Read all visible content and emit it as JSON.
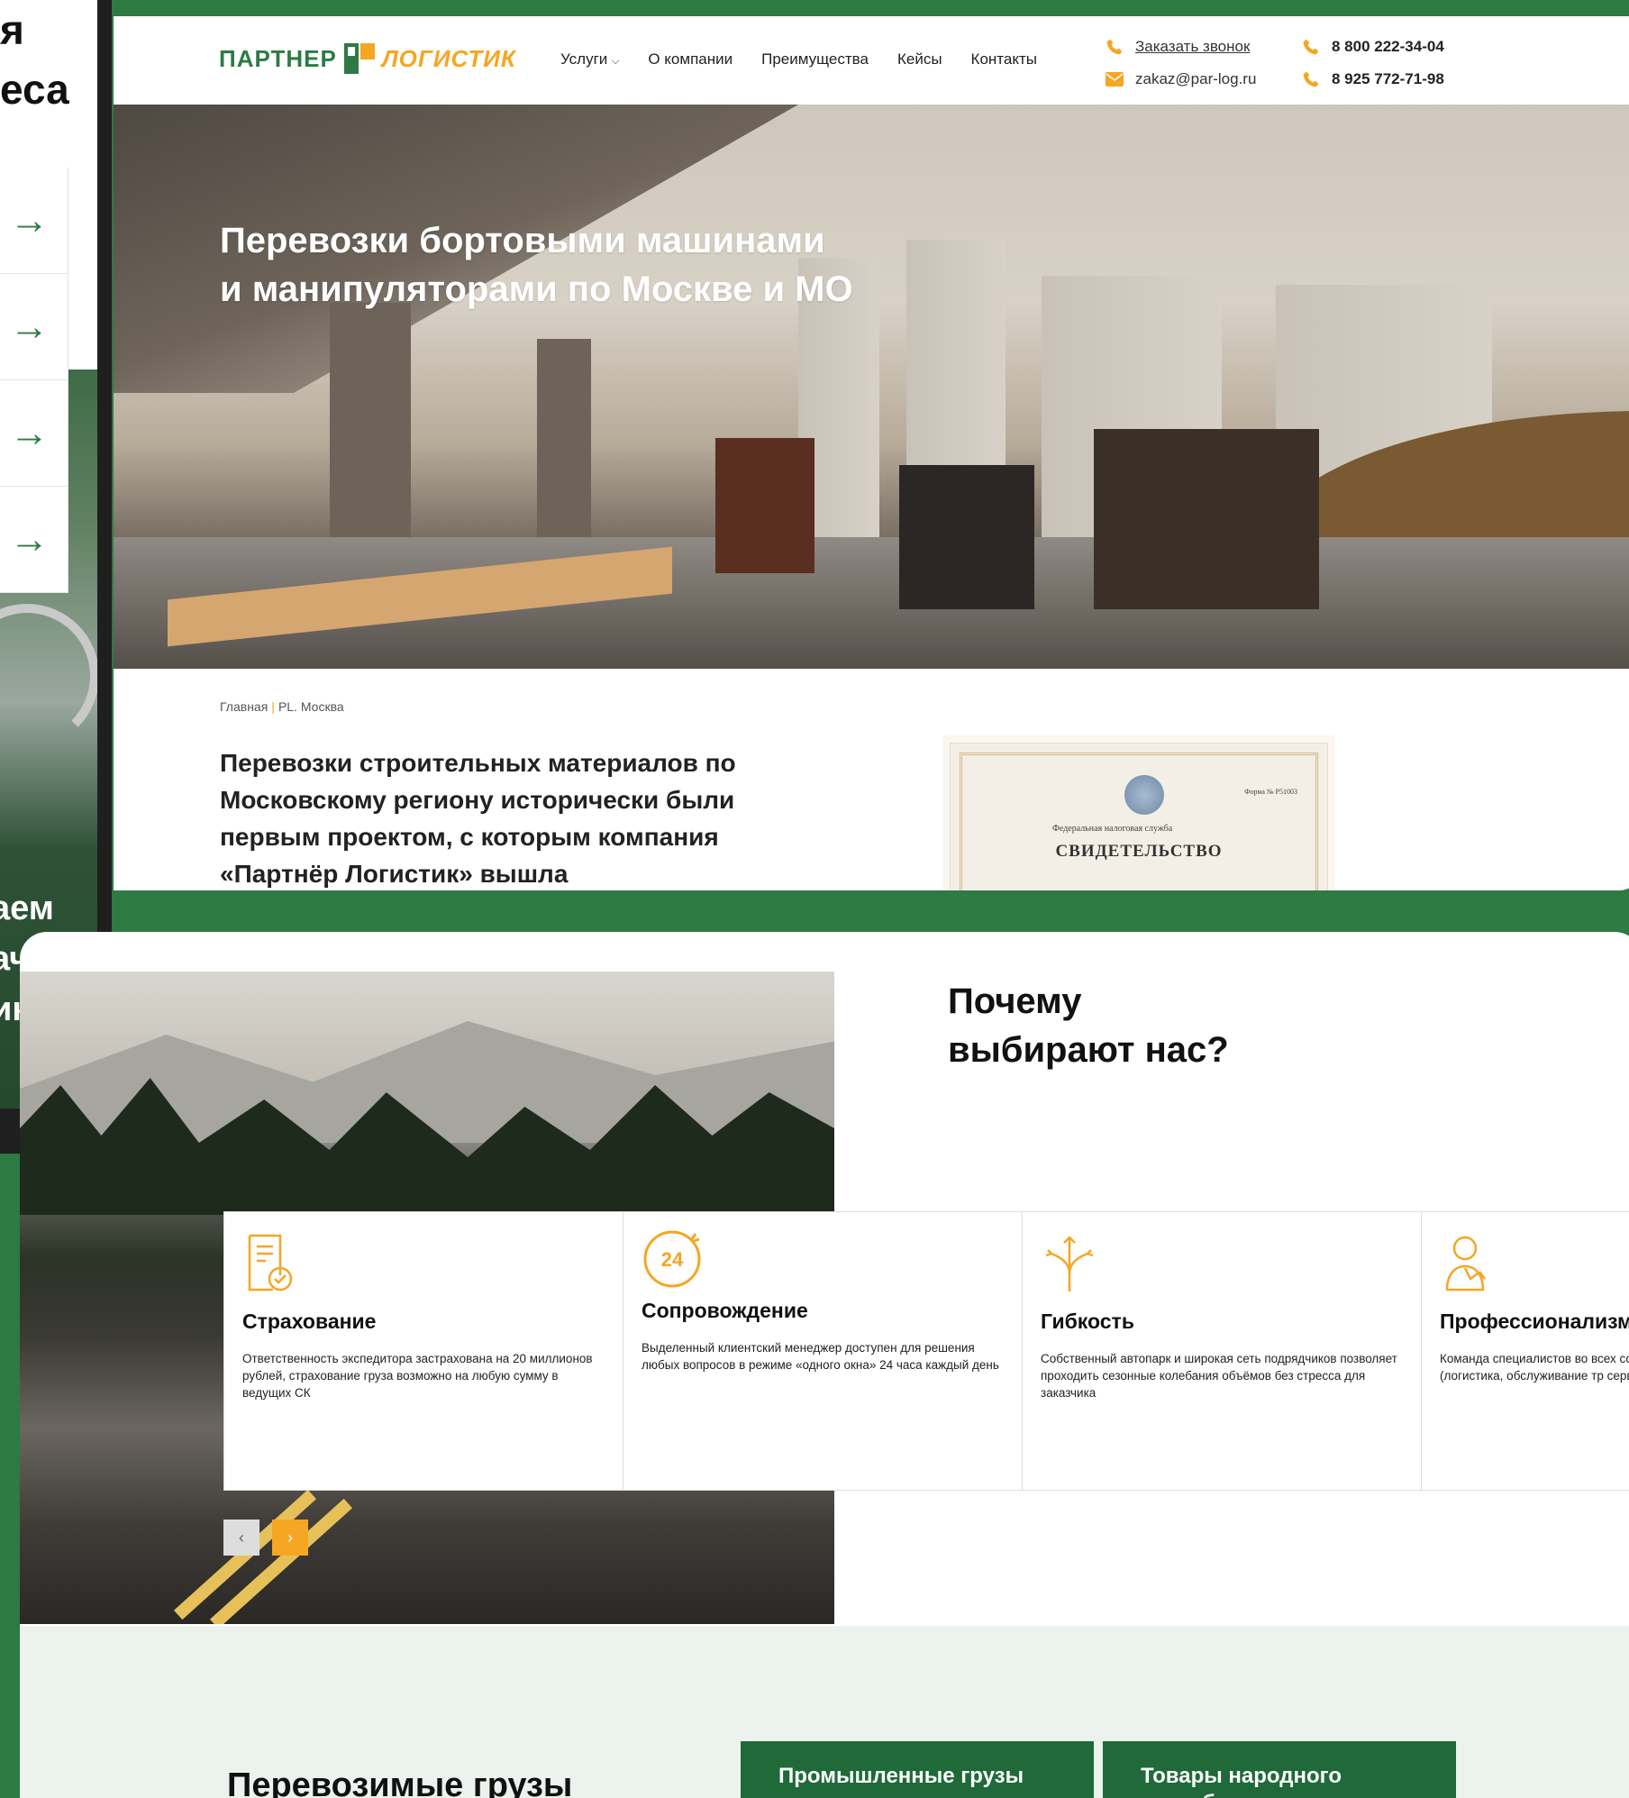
{
  "left_panel": {
    "heading_lines": [
      "я",
      "еса"
    ],
    "caption_lines": [
      "аем",
      "ачи",
      "ике"
    ]
  },
  "header": {
    "logo_word1": "ПАРТНЕР",
    "logo_word2": "ЛОГИСТИК",
    "nav": [
      "Услуги",
      "О компании",
      "Преимущества",
      "Кейсы",
      "Контакты"
    ],
    "callback_link": "Заказать звонок",
    "email": "zakaz@par-log.ru",
    "phone1": "8 800 222-34-04",
    "phone2": "8 925 772-71-98"
  },
  "hero": {
    "title_line1": "Перевозки бортовыми машинами",
    "title_line2": "и манипуляторами по Москве и МО"
  },
  "breadcrumb": {
    "home": "Главная",
    "current": "PL. Москва"
  },
  "intro": {
    "text": "Перевозки строительных материалов по Московскому региону исторически были первым проектом, с которым компания «Партнёр Логистик» вышла"
  },
  "certificate": {
    "org": "Федеральная налоговая служба",
    "form": "Форма № Р51003",
    "title": "СВИДЕТЕЛЬСТВО"
  },
  "why": {
    "title_line1": "Почему",
    "title_line2": "выбирают нас?",
    "features": [
      {
        "icon": "document-check-icon",
        "title": "Страхование",
        "text": "Ответственность экспедитора застрахована на 20 миллионов рублей, страхование груза возможно на любую сумму в ведущих СК"
      },
      {
        "icon": "24-hours-icon",
        "title": "Сопровождение",
        "text": "Выделенный клиентский менеджер доступен для решения любых вопросов в режиме «одного окна» 24 часа каждый день"
      },
      {
        "icon": "split-arrows-icon",
        "title": "Гибкость",
        "text": "Собственный автопарк и широкая сеть подрядчиков позволяет проходить сезонные колебания объёмов без стресса для заказчика"
      },
      {
        "icon": "specialist-icon",
        "title": "Профессионализм",
        "text": "Команда специалистов во всех сопровождающих транспорт (логистика, обслуживание тр сервис, IT, бухгалтерия и док"
      }
    ],
    "prev_label": "‹",
    "next_label": "›"
  },
  "cargo": {
    "title": "Перевозимые грузы",
    "buttons": [
      "Промышленные грузы",
      "Товары народного потребления"
    ]
  },
  "colors": {
    "brand_green": "#2d7a43",
    "accent_orange": "#f5a623",
    "dark_green_button": "#1f6a38"
  }
}
